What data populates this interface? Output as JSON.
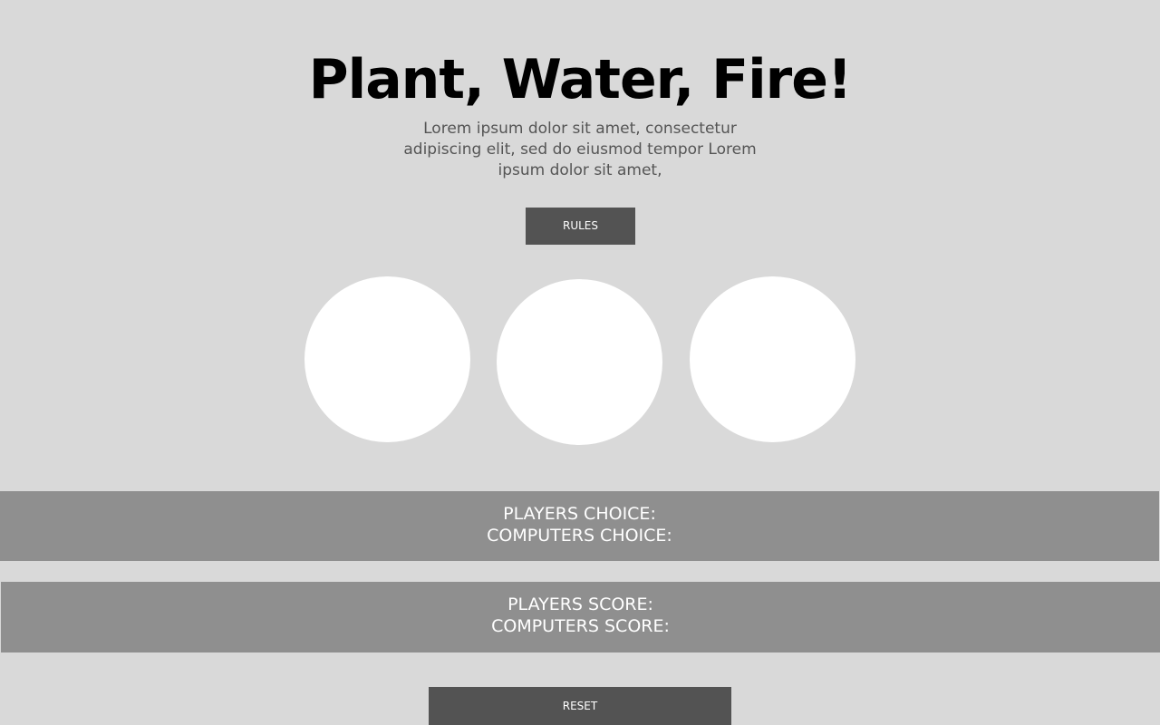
{
  "header": {
    "title": "Plant, Water, Fire!",
    "subtitle": "Lorem ipsum dolor sit amet, consectetur adipiscing elit, sed do eiusmod tempor Lorem ipsum dolor sit amet,"
  },
  "buttons": {
    "rules_label": "RULES",
    "reset_label": "RESET"
  },
  "choices_panel": {
    "player_label": "PLAYERS CHOICE:",
    "computer_label": "COMPUTERS CHOICE:"
  },
  "score_panel": {
    "player_label": "PLAYERS SCORE:",
    "computer_label": "COMPUTERS SCORE:"
  },
  "colors": {
    "background": "#d9d9d9",
    "button": "#535353",
    "panel": "#8f8f8f",
    "choice_circle": "#ffffff"
  }
}
